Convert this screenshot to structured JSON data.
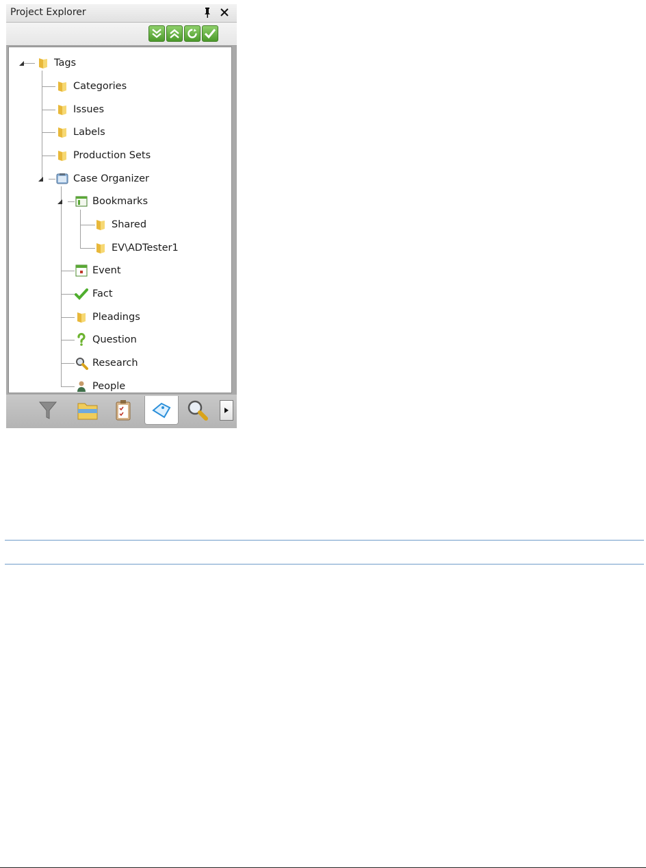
{
  "panel": {
    "title": "Project Explorer",
    "toolbar": [
      "expand-all",
      "collapse-all",
      "refresh",
      "apply"
    ],
    "tree": {
      "tags": "Tags",
      "categories": "Categories",
      "issues": "Issues",
      "labels": "Labels",
      "production_sets": "Production Sets",
      "case_organizer": "Case Organizer",
      "bookmarks": "Bookmarks",
      "shared": "Shared",
      "evadtester1": "EV\\ADTester1",
      "event": "Event",
      "fact": "Fact",
      "pleadings": "Pleadings",
      "question": "Question",
      "research": "Research",
      "people": "People"
    },
    "tabs": [
      "filter",
      "folders",
      "checklist",
      "tags",
      "search"
    ],
    "active_tab": "tags"
  },
  "colors": {
    "folder": "#f0cc5a",
    "toolbar_green": "#5aa836",
    "divider": "#6f9cc9"
  }
}
